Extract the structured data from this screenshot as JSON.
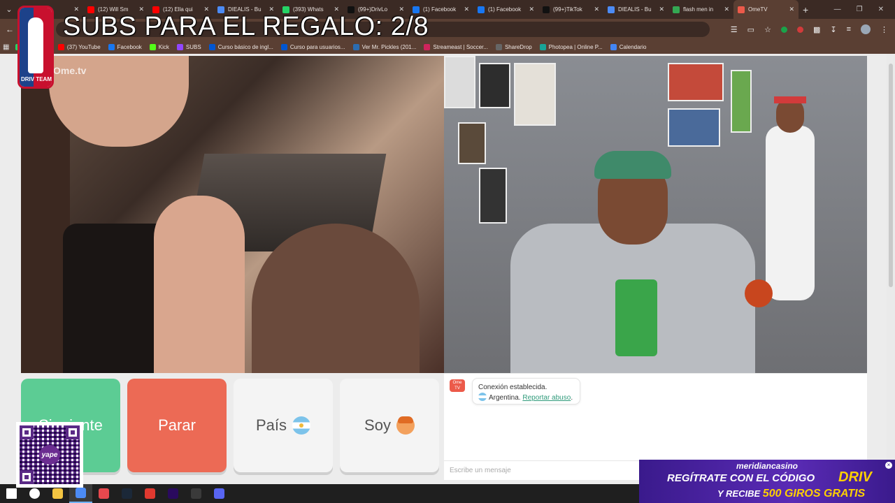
{
  "overlay": {
    "title": "SUBS PARA EL REGALO: 2/8",
    "team_label": "DRIV TEAM"
  },
  "tabs": [
    {
      "label": "Tube",
      "icon": "youtube-icon",
      "color": "#ff0000"
    },
    {
      "label": "(12) Will Sm",
      "icon": "youtube-icon",
      "color": "#ff0000"
    },
    {
      "label": "(12) Ella qui",
      "icon": "youtube-icon",
      "color": "#ff0000"
    },
    {
      "label": "DIEALIS - Bu",
      "icon": "chrome-icon",
      "color": "#4c8bf5"
    },
    {
      "label": "(393) Whats",
      "icon": "whatsapp-icon",
      "color": "#25d366"
    },
    {
      "label": "(99+)DrivLo",
      "icon": "tiktok-icon",
      "color": "#111111"
    },
    {
      "label": "(1) Facebook",
      "icon": "facebook-icon",
      "color": "#1877f2"
    },
    {
      "label": "(1) Facebook",
      "icon": "facebook-icon",
      "color": "#1877f2"
    },
    {
      "label": "(99+)TikTok",
      "icon": "tiktok-icon",
      "color": "#111111"
    },
    {
      "label": "DIEALIS - Bu",
      "icon": "chrome-icon",
      "color": "#4c8bf5"
    },
    {
      "label": "flash men in",
      "icon": "google-icon",
      "color": "#34a853"
    },
    {
      "label": "OmeTV",
      "icon": "ometv-icon",
      "color": "#ec5a4a",
      "active": true
    }
  ],
  "bookmarks": [
    {
      "label": "WhatsApp",
      "icon": "whatsapp-icon",
      "color": "#25d366"
    },
    {
      "label": "(37) YouTube",
      "icon": "youtube-icon",
      "color": "#ff0000"
    },
    {
      "label": "Facebook",
      "icon": "facebook-icon",
      "color": "#1877f2"
    },
    {
      "label": "Kick",
      "icon": "kick-icon",
      "color": "#53fc18"
    },
    {
      "label": "SUBS",
      "icon": "subs-icon",
      "color": "#9146ff"
    },
    {
      "label": "Curso básico de ingl...",
      "icon": "coursera-icon",
      "color": "#0056d2"
    },
    {
      "label": "Curso para usuarios...",
      "icon": "coursera-icon",
      "color": "#0056d2"
    },
    {
      "label": "Ver Mr. Pickles (201...",
      "icon": "site-icon",
      "color": "#2b6cb0"
    },
    {
      "label": "Streameast | Soccer...",
      "icon": "streameast-icon",
      "color": "#d0245c"
    },
    {
      "label": "ShareDrop",
      "icon": "sharedrop-icon",
      "color": "#666666"
    },
    {
      "label": "Photopea | Online P...",
      "icon": "photopea-icon",
      "color": "#18a497"
    },
    {
      "label": "Calendario",
      "icon": "calendar-icon",
      "color": "#4285f4"
    }
  ],
  "video": {
    "watermark": "Ome.tv"
  },
  "buttons": {
    "next": "Siguiente",
    "stop": "Parar",
    "country": "País",
    "me": "Soy"
  },
  "chat": {
    "logo": "Ome TV",
    "status": "Conexión establecida.",
    "country": "Argentina.",
    "report": "Reportar abuso",
    "report_suffix": ".",
    "placeholder": "Escribe un mensaje"
  },
  "qr": {
    "center": "yape"
  },
  "casino": {
    "brand": "meridiancasino",
    "line1": "REGÍTRATE CON EL CÓDIGO",
    "code": "DRIV",
    "line2_prefix": "Y RECIBE",
    "line2_highlight": "500 GIROS GRATIS"
  },
  "taskbar": [
    {
      "icon": "windows-start-icon",
      "color": "#ffffff"
    },
    {
      "icon": "search-icon",
      "color": "#ffffff"
    },
    {
      "icon": "file-explorer-icon",
      "color": "#f4c542"
    },
    {
      "icon": "chrome-icon",
      "color": "#4c8bf5"
    },
    {
      "icon": "media-player-icon",
      "color": "#e8484e"
    },
    {
      "icon": "steam-icon",
      "color": "#1b2838"
    },
    {
      "icon": "streaming-app-icon",
      "color": "#e0392f"
    },
    {
      "icon": "premiere-icon",
      "color": "#2a0a5e"
    },
    {
      "icon": "obs-icon",
      "color": "#3a3a3a"
    },
    {
      "icon": "discord-icon",
      "color": "#5865f2"
    }
  ]
}
